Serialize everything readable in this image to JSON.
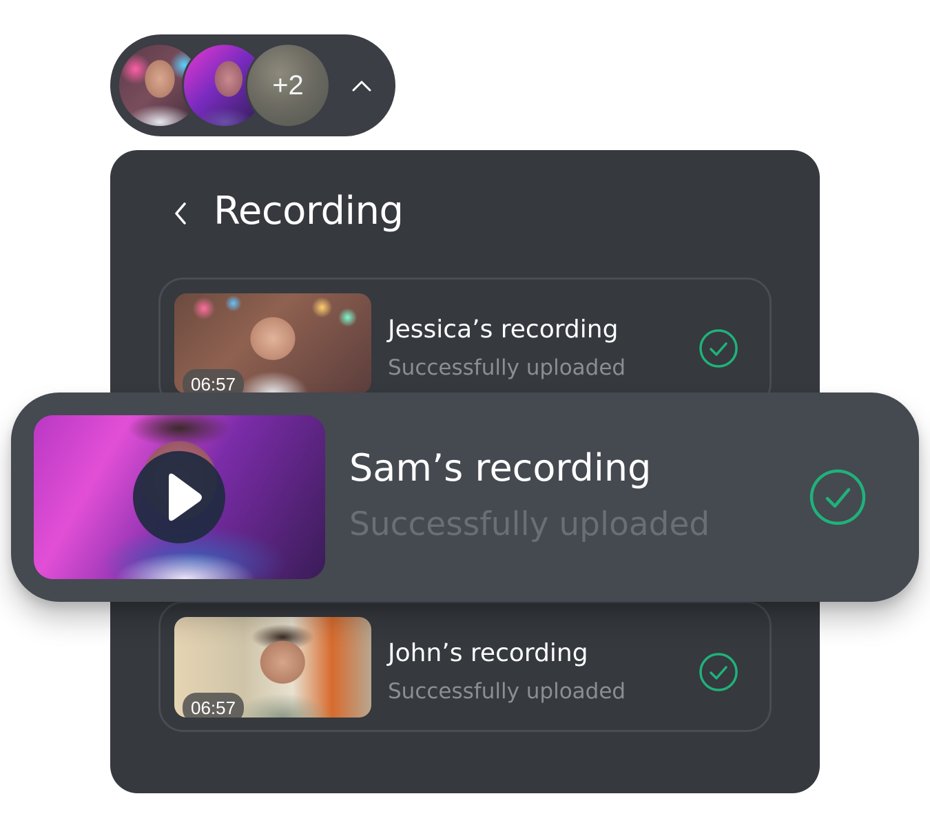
{
  "participants": {
    "more_label": "+2",
    "avatars": [
      "Jessica",
      "Sam"
    ]
  },
  "panel": {
    "title": "Recording"
  },
  "recordings": [
    {
      "name": "Jessica’s recording",
      "status": "Successfully uploaded",
      "duration": "06:57"
    },
    {
      "name": "Sam’s recording",
      "status": "Successfully uploaded"
    },
    {
      "name": "John’s recording",
      "status": "Successfully uploaded",
      "duration": "06:57"
    }
  ],
  "colors": {
    "panel_bg": "#36393e",
    "featured_bg": "#454950",
    "success": "#1fb27a"
  },
  "icons": {
    "expand": "chevron-up-icon",
    "back": "chevron-left-icon",
    "status": "check-circle-icon",
    "play": "play-icon"
  }
}
